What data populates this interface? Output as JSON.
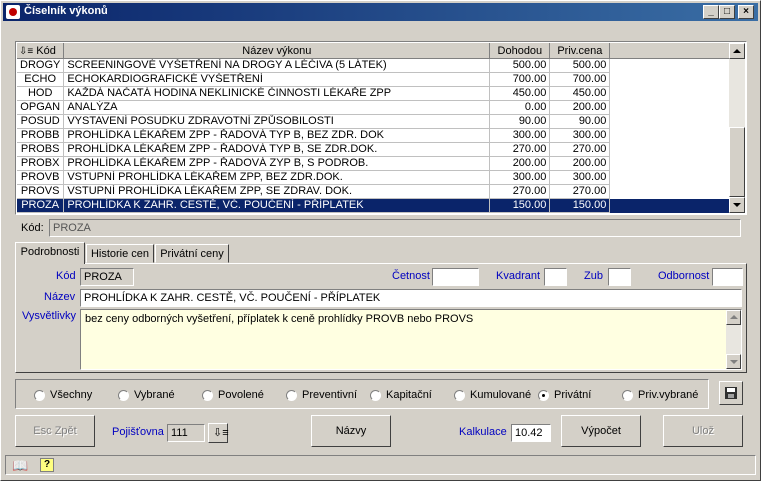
{
  "window": {
    "title": "Číselník výkonů",
    "min": "_",
    "max": "□",
    "close": "×"
  },
  "grid": {
    "columns": [
      "Kód",
      "Název výkonu",
      "Dohodou",
      "Priv.cena"
    ],
    "rows": [
      {
        "kod": "DROGY",
        "nazev": "SCREENINGOVÉ VYŠETŘENÍ NA DROGY A LÉČIVA (5 LÁTEK)",
        "dohodou": "500.00",
        "priv": "500.00"
      },
      {
        "kod": "ECHO",
        "nazev": "ECHOKARDIOGRAFICKÉ VYŠETŘENÍ",
        "dohodou": "700.00",
        "priv": "700.00"
      },
      {
        "kod": "HOD",
        "nazev": "KAŽDÁ NAČATÁ HODINA NEKLINICKÉ ČINNOSTI LÉKAŘE ZPP",
        "dohodou": "450.00",
        "priv": "450.00"
      },
      {
        "kod": "OPGAN",
        "nazev": "ANALÝZA",
        "dohodou": "0.00",
        "priv": "200.00"
      },
      {
        "kod": "POSUD",
        "nazev": "VYSTAVENÍ POSUDKU ZDRAVOTNÍ ZPŮSOBILOSTI",
        "dohodou": "90.00",
        "priv": "90.00"
      },
      {
        "kod": "PROBB",
        "nazev": "PROHLÍDKA LÉKAŘEM ZPP - ŘADOVÁ TYP B, BEZ ZDR. DOK",
        "dohodou": "300.00",
        "priv": "300.00"
      },
      {
        "kod": "PROBS",
        "nazev": "PROHLÍDKA LÉKAŘEM ZPP - ŘADOVÁ TYP B, SE ZDR.DOK.",
        "dohodou": "270.00",
        "priv": "270.00"
      },
      {
        "kod": "PROBX",
        "nazev": "PROHLÍDKA LÉKAŘEM ZPP - ŘADOVÁ ZYP B, S PODROB.",
        "dohodou": "200.00",
        "priv": "200.00"
      },
      {
        "kod": "PROVB",
        "nazev": "VSTUPNÍ PROHLÍDKA LÉKAŘEM ZPP, BEZ ZDR.DOK.",
        "dohodou": "300.00",
        "priv": "300.00"
      },
      {
        "kod": "PROVS",
        "nazev": "VSTUPNÍ PROHLÍDKA LÉKAŘEM ZPP, SE ZDRAV. DOK.",
        "dohodou": "270.00",
        "priv": "270.00"
      },
      {
        "kod": "PROZA",
        "nazev": "PROHLÍDKA K ZAHR. CESTĚ, VČ. POUČENÍ - PŘÍPLATEK",
        "dohodou": "150.00",
        "priv": "150.00"
      }
    ]
  },
  "kod_top": {
    "label": "Kód:",
    "value": "PROZA"
  },
  "tabs": [
    "Podrobnosti",
    "Historie cen",
    "Privátní ceny"
  ],
  "detail": {
    "kod_label": "Kód",
    "kod_value": "PROZA",
    "cetnost_label": "Četnost",
    "cetnost_value": "",
    "kvadrant_label": "Kvadrant",
    "kvadrant_value": "",
    "zub_label": "Zub",
    "zub_value": "",
    "odbornost_label": "Odbornost",
    "odbornost_value": "",
    "nazev_label": "Název",
    "nazev_value": "PROHLÍDKA K ZAHR. CESTĚ, VČ. POUČENÍ - PŘÍPLATEK",
    "vysvetlivky_label": "Vysvětlivky",
    "vysvetlivky_value": "bez ceny odborných vyšetření, příplatek k ceně prohlídky PROVB nebo PROVS"
  },
  "filters": [
    {
      "label": "Všechny",
      "checked": false
    },
    {
      "label": "Vybrané",
      "checked": false
    },
    {
      "label": "Povolené",
      "checked": false
    },
    {
      "label": "Preventivní",
      "checked": false
    },
    {
      "label": "Kapitační",
      "checked": false
    },
    {
      "label": "Kumulované",
      "checked": false
    },
    {
      "label": "Privátní",
      "checked": true
    },
    {
      "label": "Priv.vybrané",
      "checked": false
    }
  ],
  "bottom": {
    "esc_label": "Esc Zpět",
    "pojistovna_label": "Pojišťovna",
    "pojistovna_value": "111",
    "nazvy_label": "Názvy",
    "kalkulace_label": "Kalkulace",
    "kalkulace_value": "10.42",
    "vypocet_label": "Výpočet",
    "uloz_label": "Ulož"
  }
}
